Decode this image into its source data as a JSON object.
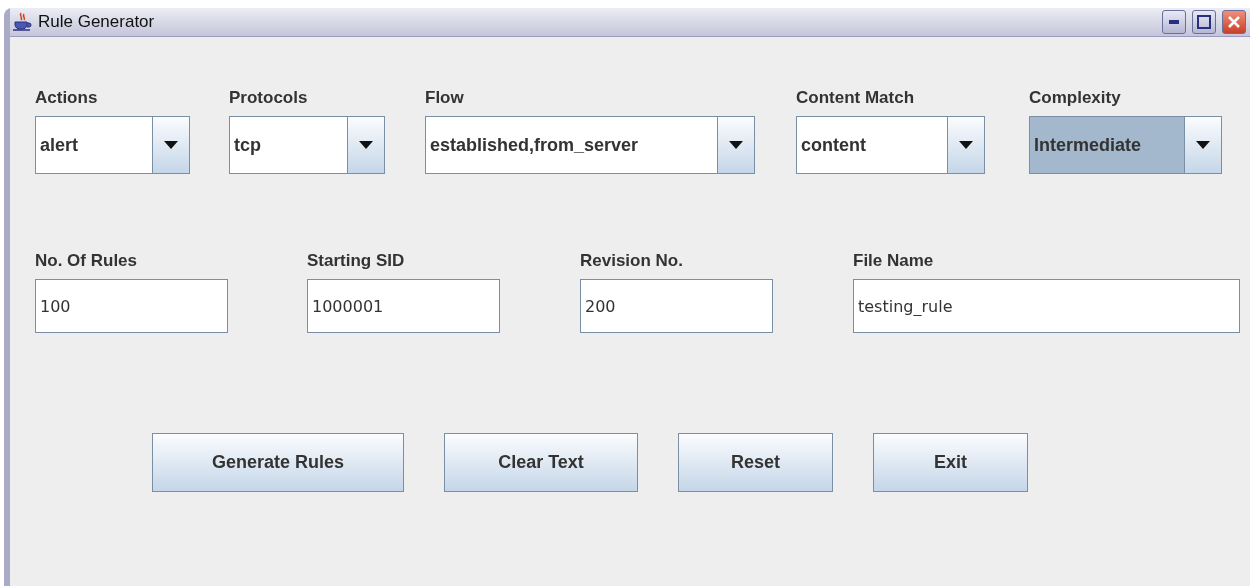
{
  "window": {
    "title": "Rule Generator"
  },
  "dropdowns": [
    {
      "label": "Actions",
      "value": "alert",
      "focused": false
    },
    {
      "label": "Protocols",
      "value": "tcp",
      "focused": false
    },
    {
      "label": "Flow",
      "value": "established,from_server",
      "focused": false
    },
    {
      "label": "Content Match",
      "value": "content",
      "focused": false
    },
    {
      "label": "Complexity",
      "value": "Intermediate",
      "focused": true
    }
  ],
  "fields": [
    {
      "label": "No. Of Rules",
      "value": "100"
    },
    {
      "label": "Starting SID",
      "value": "1000001"
    },
    {
      "label": "Revision No.",
      "value": "200"
    },
    {
      "label": "File Name",
      "value": "testing_rule"
    }
  ],
  "buttons": [
    "Generate Rules",
    "Clear Text",
    "Reset",
    "Exit"
  ]
}
